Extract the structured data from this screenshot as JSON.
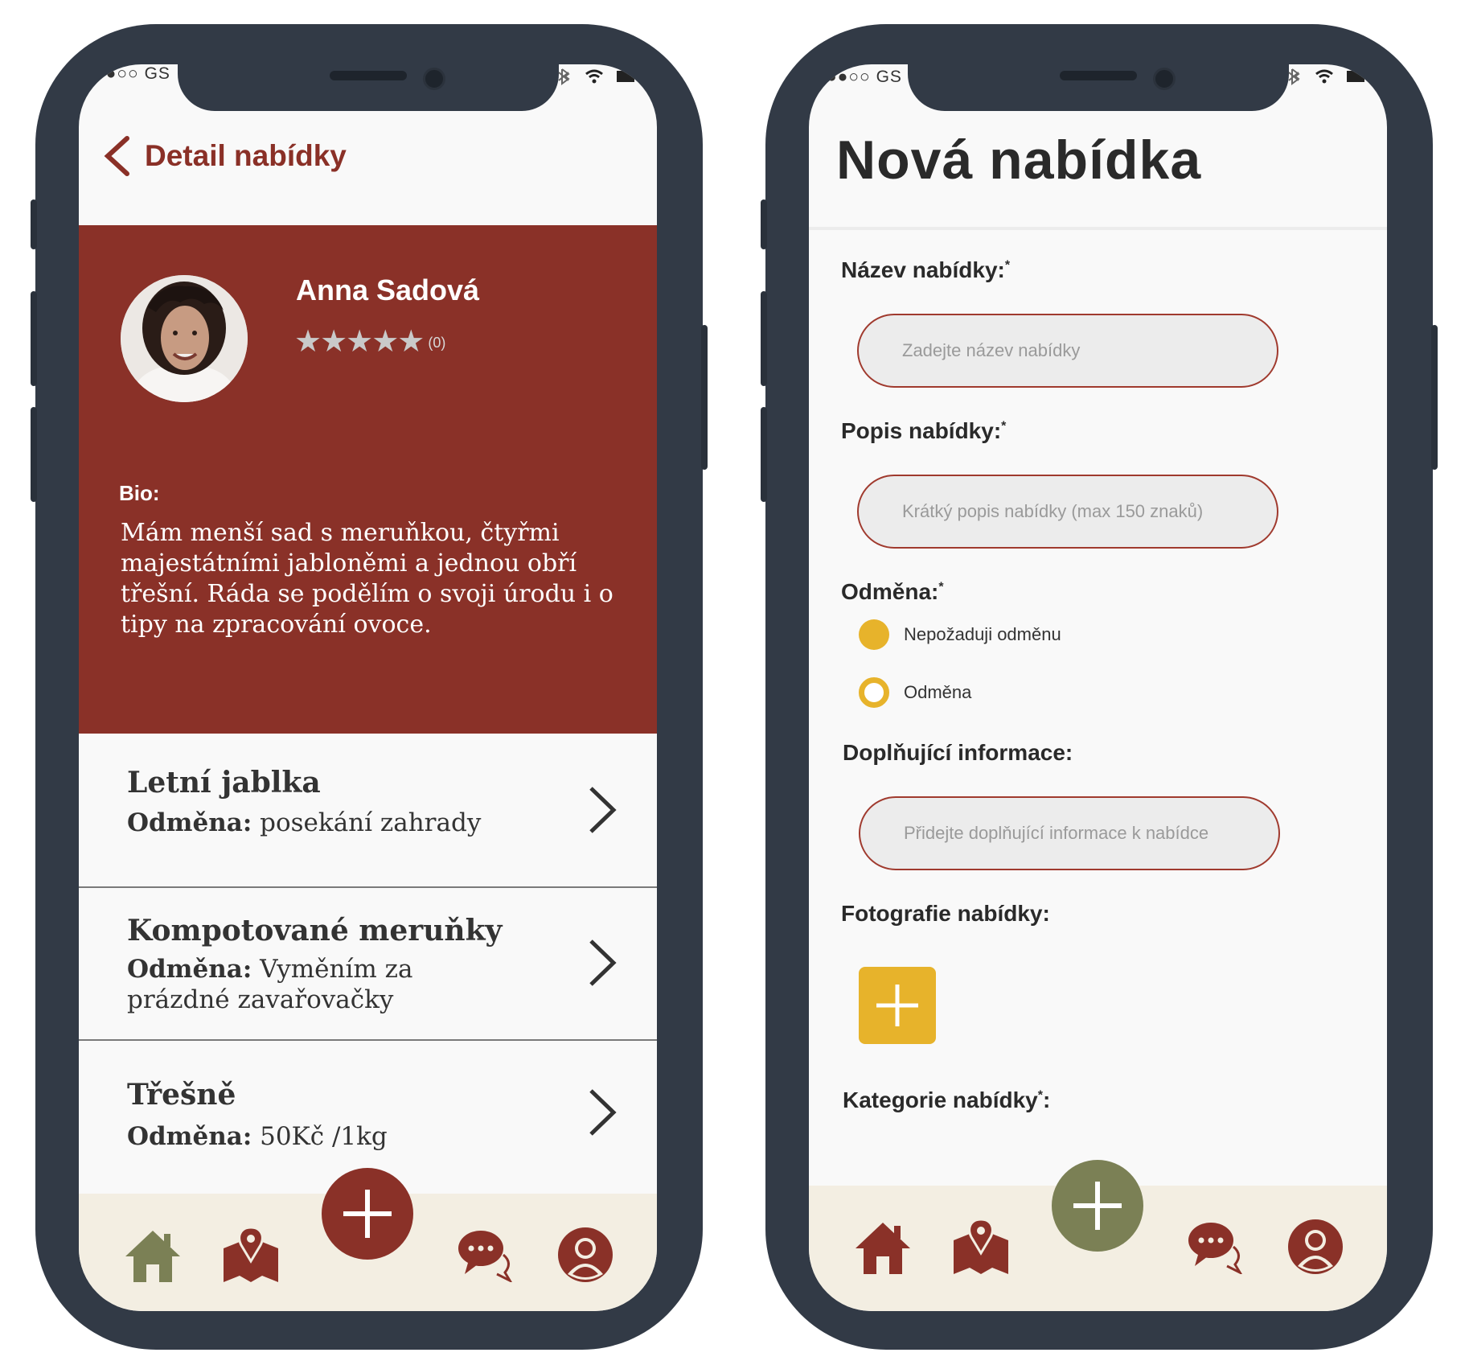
{
  "status_bar": {
    "carrier": "●●○○ GS"
  },
  "left_screen": {
    "header": {
      "title": "Detail nabídky"
    },
    "profile": {
      "name": "Anna Sadová",
      "stars": "★★★★★",
      "rating_count": "(0)",
      "bio_label": "Bio:",
      "bio_text": "Mám menší sad s meruňkou, čtyřmi majestátními jabloněmi a jednou obří třešní. Ráda se podělím o svoji úrodu i o tipy na zpracování ovoce."
    },
    "offers": [
      {
        "title": "Letní jablka",
        "reward_label": "Odměna:",
        "reward_value": "posekání zahrady"
      },
      {
        "title": "Kompotované meruňky",
        "reward_label": "Odměna:",
        "reward_value": "Vyměním za prázdné zavařovačky"
      },
      {
        "title": "Třešně",
        "reward_label": "Odměna:",
        "reward_value": "50Kč /1kg"
      }
    ],
    "nav_icons": [
      "home-icon",
      "map-icon",
      "add-icon",
      "chat-icon",
      "profile-icon"
    ]
  },
  "right_screen": {
    "title": "Nová nabídka",
    "fields": {
      "name_label": "Název nabídky:",
      "name_required": "*",
      "name_placeholder": "Zadejte název nabídky",
      "desc_label": "Popis nabídky:",
      "desc_required": "*",
      "desc_placeholder": "Krátký popis nabídky (max 150 znaků)",
      "reward_label": "Odměna:",
      "reward_required": "*",
      "reward_options": [
        "Nepožaduji odměnu",
        "Odměna"
      ],
      "reward_selected": "Nepožaduji odměnu",
      "extra_label": "Doplňující informace:",
      "extra_placeholder": "Přidejte doplňující informace k nabídce",
      "photo_label": "Fotografie nabídky:",
      "category_label": "Kategorie nabídky",
      "category_required": "*",
      "category_colon": ":"
    },
    "nav_icons": [
      "home-icon",
      "map-icon",
      "add-icon",
      "chat-icon",
      "profile-icon"
    ]
  },
  "colors": {
    "brand_red": "#8a3128",
    "accent_yellow": "#e7b32b",
    "olive": "#7b8055",
    "nav_bg": "#f3eee2",
    "frame": "#323a46"
  }
}
